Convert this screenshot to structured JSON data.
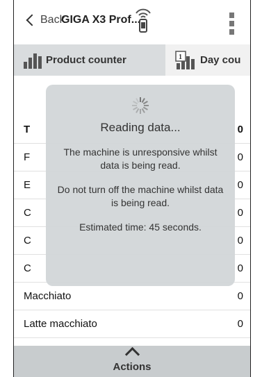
{
  "navbar": {
    "back_label": "Back",
    "title": "GIGA X3 Prof..."
  },
  "tabs": [
    {
      "label": "Product counter",
      "icon": "bar-chart-icon",
      "active": true
    },
    {
      "label": "Day cou",
      "icon": "calendar-bar-chart-icon",
      "active": false
    }
  ],
  "list": {
    "rows": [
      {
        "name": "T",
        "value": "0"
      },
      {
        "name": "F",
        "value": "0"
      },
      {
        "name": "E",
        "value": "0"
      },
      {
        "name": "C",
        "value": "0"
      },
      {
        "name": "C",
        "value": "0"
      },
      {
        "name": "C",
        "value": "0"
      },
      {
        "name": "Macchiato",
        "value": "0"
      },
      {
        "name": "Latte macchiato",
        "value": "0"
      }
    ]
  },
  "actions": {
    "label": "Actions"
  },
  "modal": {
    "heading": "Reading data...",
    "line1": "The machine is unresponsive whilst data is being read.",
    "line2": "Do not turn off the machine whilst data is being read.",
    "line3": "Estimated time: 45 seconds."
  }
}
